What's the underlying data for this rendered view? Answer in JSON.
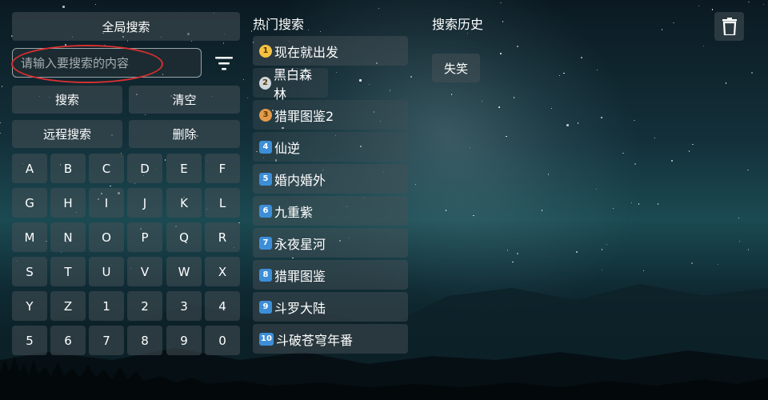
{
  "left": {
    "global_search_label": "全局搜索",
    "search_placeholder": "请输入要搜索的内容",
    "search_value": "",
    "search_button": "搜索",
    "clear_button": "清空",
    "remote_search_button": "远程搜索",
    "delete_button": "删除",
    "filter_icon": "filter-icon",
    "keys": [
      "A",
      "B",
      "C",
      "D",
      "E",
      "F",
      "G",
      "H",
      "I",
      "J",
      "K",
      "L",
      "M",
      "N",
      "O",
      "P",
      "Q",
      "R",
      "S",
      "T",
      "U",
      "V",
      "W",
      "X",
      "Y",
      "Z",
      "1",
      "2",
      "3",
      "4",
      "5",
      "6",
      "7",
      "8",
      "9",
      "0"
    ]
  },
  "hot": {
    "title": "热门搜索",
    "items": [
      {
        "rank": "1",
        "label": "现在就出发"
      },
      {
        "rank": "2",
        "label": "黑白森林"
      },
      {
        "rank": "3",
        "label": "猎罪图鉴2"
      },
      {
        "rank": "4",
        "label": "仙逆"
      },
      {
        "rank": "5",
        "label": "婚内婚外"
      },
      {
        "rank": "6",
        "label": "九重紫"
      },
      {
        "rank": "7",
        "label": "永夜星河"
      },
      {
        "rank": "8",
        "label": "猎罪图鉴"
      },
      {
        "rank": "9",
        "label": "斗罗大陆"
      },
      {
        "rank": "10",
        "label": "斗破苍穹年番"
      }
    ],
    "medal_colors": [
      "#f5c242",
      "#cfd6dc",
      "#e59a4a"
    ],
    "number_badge_color": "#3d8ed8"
  },
  "history": {
    "title": "搜索历史",
    "items": [
      "失笑"
    ],
    "trash_icon": "trash-icon"
  },
  "colors": {
    "annotation": "#d8302f"
  }
}
